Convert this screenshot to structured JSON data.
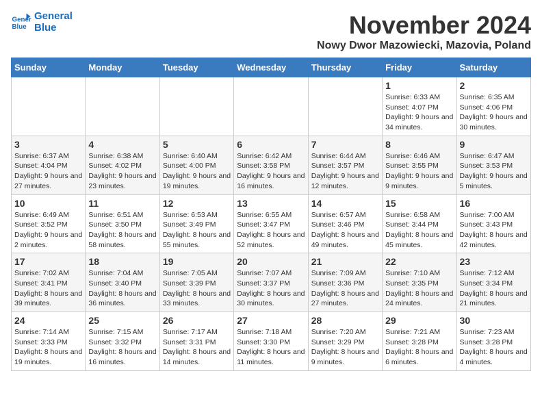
{
  "logo": {
    "line1": "General",
    "line2": "Blue"
  },
  "title": "November 2024",
  "location": "Nowy Dwor Mazowiecki, Mazovia, Poland",
  "days_of_week": [
    "Sunday",
    "Monday",
    "Tuesday",
    "Wednesday",
    "Thursday",
    "Friday",
    "Saturday"
  ],
  "weeks": [
    [
      {
        "day": "",
        "info": ""
      },
      {
        "day": "",
        "info": ""
      },
      {
        "day": "",
        "info": ""
      },
      {
        "day": "",
        "info": ""
      },
      {
        "day": "",
        "info": ""
      },
      {
        "day": "1",
        "info": "Sunrise: 6:33 AM\nSunset: 4:07 PM\nDaylight: 9 hours and 34 minutes."
      },
      {
        "day": "2",
        "info": "Sunrise: 6:35 AM\nSunset: 4:06 PM\nDaylight: 9 hours and 30 minutes."
      }
    ],
    [
      {
        "day": "3",
        "info": "Sunrise: 6:37 AM\nSunset: 4:04 PM\nDaylight: 9 hours and 27 minutes."
      },
      {
        "day": "4",
        "info": "Sunrise: 6:38 AM\nSunset: 4:02 PM\nDaylight: 9 hours and 23 minutes."
      },
      {
        "day": "5",
        "info": "Sunrise: 6:40 AM\nSunset: 4:00 PM\nDaylight: 9 hours and 19 minutes."
      },
      {
        "day": "6",
        "info": "Sunrise: 6:42 AM\nSunset: 3:58 PM\nDaylight: 9 hours and 16 minutes."
      },
      {
        "day": "7",
        "info": "Sunrise: 6:44 AM\nSunset: 3:57 PM\nDaylight: 9 hours and 12 minutes."
      },
      {
        "day": "8",
        "info": "Sunrise: 6:46 AM\nSunset: 3:55 PM\nDaylight: 9 hours and 9 minutes."
      },
      {
        "day": "9",
        "info": "Sunrise: 6:47 AM\nSunset: 3:53 PM\nDaylight: 9 hours and 5 minutes."
      }
    ],
    [
      {
        "day": "10",
        "info": "Sunrise: 6:49 AM\nSunset: 3:52 PM\nDaylight: 9 hours and 2 minutes."
      },
      {
        "day": "11",
        "info": "Sunrise: 6:51 AM\nSunset: 3:50 PM\nDaylight: 8 hours and 58 minutes."
      },
      {
        "day": "12",
        "info": "Sunrise: 6:53 AM\nSunset: 3:49 PM\nDaylight: 8 hours and 55 minutes."
      },
      {
        "day": "13",
        "info": "Sunrise: 6:55 AM\nSunset: 3:47 PM\nDaylight: 8 hours and 52 minutes."
      },
      {
        "day": "14",
        "info": "Sunrise: 6:57 AM\nSunset: 3:46 PM\nDaylight: 8 hours and 49 minutes."
      },
      {
        "day": "15",
        "info": "Sunrise: 6:58 AM\nSunset: 3:44 PM\nDaylight: 8 hours and 45 minutes."
      },
      {
        "day": "16",
        "info": "Sunrise: 7:00 AM\nSunset: 3:43 PM\nDaylight: 8 hours and 42 minutes."
      }
    ],
    [
      {
        "day": "17",
        "info": "Sunrise: 7:02 AM\nSunset: 3:41 PM\nDaylight: 8 hours and 39 minutes."
      },
      {
        "day": "18",
        "info": "Sunrise: 7:04 AM\nSunset: 3:40 PM\nDaylight: 8 hours and 36 minutes."
      },
      {
        "day": "19",
        "info": "Sunrise: 7:05 AM\nSunset: 3:39 PM\nDaylight: 8 hours and 33 minutes."
      },
      {
        "day": "20",
        "info": "Sunrise: 7:07 AM\nSunset: 3:37 PM\nDaylight: 8 hours and 30 minutes."
      },
      {
        "day": "21",
        "info": "Sunrise: 7:09 AM\nSunset: 3:36 PM\nDaylight: 8 hours and 27 minutes."
      },
      {
        "day": "22",
        "info": "Sunrise: 7:10 AM\nSunset: 3:35 PM\nDaylight: 8 hours and 24 minutes."
      },
      {
        "day": "23",
        "info": "Sunrise: 7:12 AM\nSunset: 3:34 PM\nDaylight: 8 hours and 21 minutes."
      }
    ],
    [
      {
        "day": "24",
        "info": "Sunrise: 7:14 AM\nSunset: 3:33 PM\nDaylight: 8 hours and 19 minutes."
      },
      {
        "day": "25",
        "info": "Sunrise: 7:15 AM\nSunset: 3:32 PM\nDaylight: 8 hours and 16 minutes."
      },
      {
        "day": "26",
        "info": "Sunrise: 7:17 AM\nSunset: 3:31 PM\nDaylight: 8 hours and 14 minutes."
      },
      {
        "day": "27",
        "info": "Sunrise: 7:18 AM\nSunset: 3:30 PM\nDaylight: 8 hours and 11 minutes."
      },
      {
        "day": "28",
        "info": "Sunrise: 7:20 AM\nSunset: 3:29 PM\nDaylight: 8 hours and 9 minutes."
      },
      {
        "day": "29",
        "info": "Sunrise: 7:21 AM\nSunset: 3:28 PM\nDaylight: 8 hours and 6 minutes."
      },
      {
        "day": "30",
        "info": "Sunrise: 7:23 AM\nSunset: 3:28 PM\nDaylight: 8 hours and 4 minutes."
      }
    ]
  ]
}
